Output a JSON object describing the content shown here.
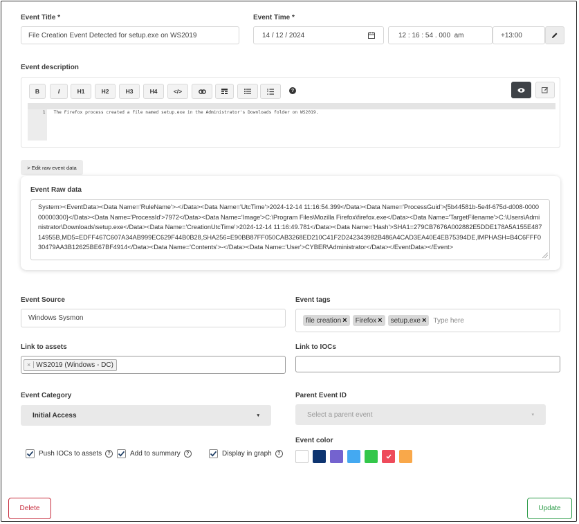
{
  "event_title": {
    "label": "Event Title *",
    "value": "File Creation Event Detected for setup.exe on WS2019"
  },
  "event_time": {
    "label": "Event Time *",
    "date": "14 / 12 / 2024",
    "time": "12 : 16 : 54 . 000  am",
    "timezone": "+13:00"
  },
  "description": {
    "label": "Event description",
    "toolbar": [
      "B",
      "I",
      "H1",
      "H2",
      "H3",
      "H4",
      "</>",
      "link",
      "table",
      "ul",
      "ol",
      "help"
    ],
    "line_number": "1",
    "text": "The Firefox process created a file named setup.exe in the Administrator's Downloads folder on WS2019."
  },
  "edit_raw_button": "> Edit raw event data",
  "raw": {
    "label": "Event Raw data",
    "text": "System><EventData><Data Name='RuleName'>-</Data><Data Name='UtcTime'>2024-12-14 11:16:54.399</Data><Data Name='ProcessGuid'>{5b44581b-5e4f-675d-d008-000000000300}</Data><Data Name='ProcessId'>7972</Data><Data Name='Image'>C:\\Program Files\\Mozilla Firefox\\firefox.exe</Data><Data Name='TargetFilename'>C:\\Users\\Administrator\\Downloads\\setup.exe</Data><Data Name='CreationUtcTime'>2024-12-14 11:16:49.781</Data><Data Name='Hash'>SHA1=279CB7676A002882E5DDE178A5A155E48714955B,MD5=EDFF467C607A34AB999EC629F44B0B28,SHA256=E90BB87FF050CAB3268ED210C41F2D242343982B486A4CAD3EA40E4EB75394DE,IMPHASH=B4C6FFF030479AA3B12625BE67BF4914</Data><Data Name='Contents'>-</Data><Data Name='User'>CYBER\\Administrator</Data></EventData></Event>"
  },
  "source": {
    "label": "Event Source",
    "value": "Windows Sysmon"
  },
  "tags": {
    "label": "Event tags",
    "items": [
      "file creation",
      "Firefox",
      "setup.exe"
    ],
    "placeholder": "Type here"
  },
  "assets": {
    "label": "Link to assets",
    "items": [
      "WS2019 (Windows - DC)"
    ]
  },
  "iocs": {
    "label": "Link to IOCs",
    "value": ""
  },
  "category": {
    "label": "Event Category",
    "value": "Initial Access"
  },
  "parent": {
    "label": "Parent Event ID",
    "placeholder": "Select a parent event"
  },
  "checkboxes": [
    {
      "label": "Push IOCs to assets",
      "checked": true
    },
    {
      "label": "Add to summary",
      "checked": true
    },
    {
      "label": "Display in graph",
      "checked": true
    }
  ],
  "color": {
    "label": "Event color",
    "swatches": [
      "#ffffff",
      "#0d3470",
      "#7463cf",
      "#44a9f1",
      "#33c74a",
      "#ee4b5b",
      "#f9a84a"
    ],
    "selected_index": 5
  },
  "buttons": {
    "delete": "Delete",
    "update": "Update"
  },
  "colors": {
    "delete": "#c6293a",
    "update": "#2b9b47"
  }
}
